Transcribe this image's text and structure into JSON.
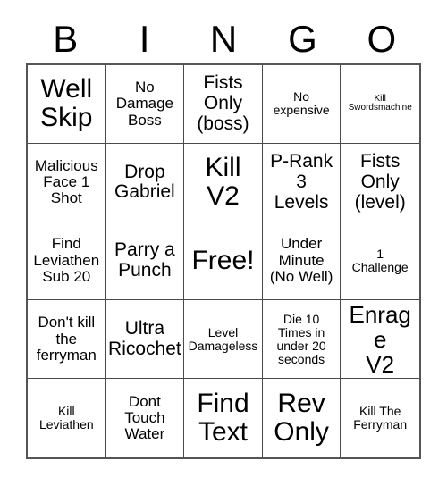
{
  "card": {
    "headers": [
      "B",
      "I",
      "N",
      "G",
      "O"
    ],
    "cells": [
      {
        "text": "Well\nSkip",
        "size": "s-xxl"
      },
      {
        "text": "No\nDamage\nBoss",
        "size": "s-md"
      },
      {
        "text": "Fists\nOnly\n(boss)",
        "size": "s-lg"
      },
      {
        "text": "No\nexpensive",
        "size": "s-sm"
      },
      {
        "text": "Kill\nSwordsmachine",
        "size": "s-xs"
      },
      {
        "text": "Malicious\nFace 1\nShot",
        "size": "s-md"
      },
      {
        "text": "Drop\nGabriel",
        "size": "s-lg"
      },
      {
        "text": "Kill\nV2",
        "size": "s-xxl"
      },
      {
        "text": "P-Rank\n3\nLevels",
        "size": "s-lg"
      },
      {
        "text": "Fists\nOnly\n(level)",
        "size": "s-lg"
      },
      {
        "text": "Find\nLeviathen\nSub 20",
        "size": "s-md"
      },
      {
        "text": "Parry a\nPunch",
        "size": "s-lg"
      },
      {
        "text": "Free!",
        "size": "s-xxl"
      },
      {
        "text": "Under\nMinute\n(No Well)",
        "size": "s-md"
      },
      {
        "text": "1\nChallenge",
        "size": "s-sm"
      },
      {
        "text": "Don't kill\nthe\nferryman",
        "size": "s-md"
      },
      {
        "text": "Ultra\nRicochet",
        "size": "s-lg"
      },
      {
        "text": "Level\nDamageless",
        "size": "s-sm"
      },
      {
        "text": "Die 10\nTimes in\nunder 20\nseconds",
        "size": "s-sm"
      },
      {
        "text": "Enrage\nV2",
        "size": "s-xl"
      },
      {
        "text": "Kill\nLeviathen",
        "size": "s-sm"
      },
      {
        "text": "Dont\nTouch\nWater",
        "size": "s-md"
      },
      {
        "text": "Find\nText",
        "size": "s-xxl"
      },
      {
        "text": "Rev\nOnly",
        "size": "s-xxl"
      },
      {
        "text": "Kill The\nFerryman",
        "size": "s-sm"
      }
    ]
  }
}
